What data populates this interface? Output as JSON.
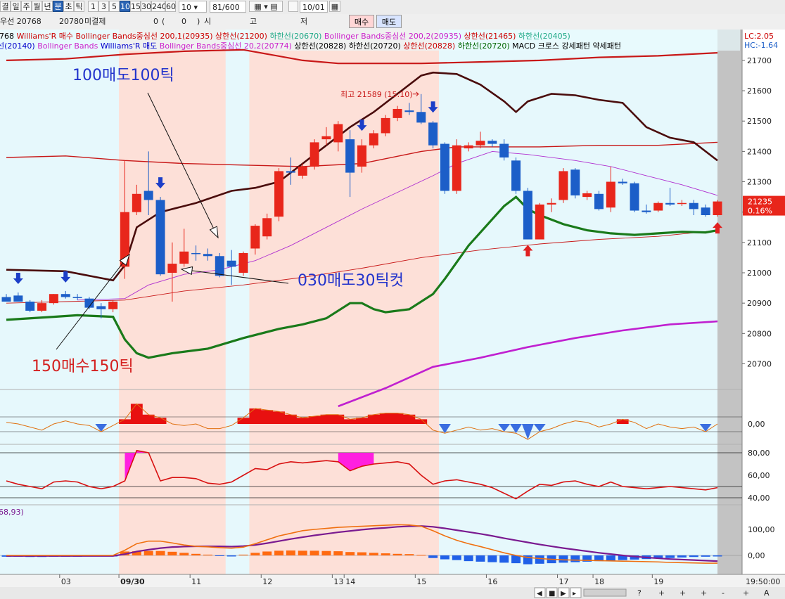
{
  "toolbar": {
    "period_tabs": [
      "결",
      "일",
      "주",
      "월",
      "년",
      "분",
      "초",
      "틱"
    ],
    "interval_buttons": [
      "1",
      "3",
      "5",
      "10",
      "15",
      "30",
      "240",
      "60"
    ],
    "selected_period": "분",
    "selected_interval": "10",
    "interval_value": "10",
    "bar_count": "81/600",
    "date_value": "10/01"
  },
  "toolbar2": {
    "item_code": "768",
    "item_label": "우선 20768",
    "price": "20780",
    "unsettled_label": "미결제",
    "unsettled_value": "0",
    "paren_value": "0",
    "open_label": "시",
    "high_label": "고",
    "low_label": "저",
    "buy_button": "매수",
    "sell_button": "매도"
  },
  "legend_line1": [
    {
      "text": "768",
      "color": "#000000"
    },
    {
      "text": "Williams'R 매수",
      "color": "#cc0000"
    },
    {
      "text": "Bollinger Bands중심선 200,1(20935)",
      "color": "#cc0000"
    },
    {
      "text": "상한선(21200)",
      "color": "#cc0000"
    },
    {
      "text": "하한선(20670)",
      "color": "#22aa88"
    },
    {
      "text": "Bollinger Bands중심선 200,2(20935)",
      "color": "#cc22cc"
    },
    {
      "text": "상한선(21465)",
      "color": "#cc0000"
    },
    {
      "text": "하한선(20405)",
      "color": "#22aa88"
    }
  ],
  "legend_line2": [
    {
      "text": "선(20140)",
      "color": "#0000cc"
    },
    {
      "text": "Bollinger Bands",
      "color": "#cc22cc"
    },
    {
      "text": "Williams'R 매도",
      "color": "#0000cc"
    },
    {
      "text": "Bollinger Bands중심선 20,2(20774)",
      "color": "#cc22cc"
    },
    {
      "text": "상한선(20828)",
      "color": "#000000"
    },
    {
      "text": "하한선(20720)",
      "color": "#000000"
    },
    {
      "text": "상한선(20828)",
      "color": "#cc0000"
    },
    {
      "text": "하한선(20720)",
      "color": "#006600"
    },
    {
      "text": "MACD 크로스 강세패턴  약세패턴",
      "color": "#000000"
    }
  ],
  "indicator_corner": {
    "lc": "LC:2.05",
    "hc": "HC:-1.64"
  },
  "annotations": {
    "sell100": "100매도100틱",
    "sell30": "030매도30틱컷",
    "buy150": "150매수150틱",
    "high_label": "최고 21589 (15:10)"
  },
  "price_tag": {
    "price": "21235",
    "pct": "0.16%"
  },
  "macd_left_label": "68,93)",
  "time_label": "19:50:00",
  "colors": {
    "up": "#e8261b",
    "down": "#1c5ec8",
    "pink_band": "#fde0d8",
    "cyan_bg": "#e6f8fc",
    "upper_band_dark": "#4a0c0c",
    "lower_band": "#1a7a1a",
    "magenta_line": "#c020d0"
  },
  "chart_data": {
    "type": "candlestick",
    "ylim": [
      20620,
      21760
    ],
    "y_ticks": [
      21700,
      21600,
      21500,
      21400,
      21300,
      21200,
      21100,
      21000,
      20900,
      20800,
      20700
    ],
    "x_ticks": [
      "03",
      "09/30",
      "11",
      "12",
      "13",
      "14",
      "15",
      "16",
      "17",
      "18",
      "19"
    ],
    "candles": [
      {
        "o": 20920,
        "h": 20930,
        "l": 20905,
        "c": 20905
      },
      {
        "o": 20925,
        "h": 20935,
        "l": 20905,
        "c": 20905
      },
      {
        "o": 20905,
        "h": 20910,
        "l": 20870,
        "c": 20875
      },
      {
        "o": 20875,
        "h": 20910,
        "l": 20870,
        "c": 20900
      },
      {
        "o": 20900,
        "h": 20930,
        "l": 20895,
        "c": 20930
      },
      {
        "o": 20930,
        "h": 20940,
        "l": 20915,
        "c": 20920
      },
      {
        "o": 20920,
        "h": 20930,
        "l": 20910,
        "c": 20918
      },
      {
        "o": 20915,
        "h": 20920,
        "l": 20880,
        "c": 20885
      },
      {
        "o": 20890,
        "h": 20900,
        "l": 20850,
        "c": 20880
      },
      {
        "o": 20880,
        "h": 20910,
        "l": 20870,
        "c": 20905
      },
      {
        "o": 21020,
        "h": 21370,
        "l": 20980,
        "c": 21200
      },
      {
        "o": 21200,
        "h": 21290,
        "l": 21190,
        "c": 21260
      },
      {
        "o": 21270,
        "h": 21400,
        "l": 21190,
        "c": 21240
      },
      {
        "o": 21240,
        "h": 21250,
        "l": 20990,
        "c": 20995
      },
      {
        "o": 21000,
        "h": 21100,
        "l": 20905,
        "c": 21030
      },
      {
        "o": 21030,
        "h": 21145,
        "l": 21020,
        "c": 21070
      },
      {
        "o": 21065,
        "h": 21090,
        "l": 21040,
        "c": 21062
      },
      {
        "o": 21062,
        "h": 21080,
        "l": 21040,
        "c": 21055
      },
      {
        "o": 21055,
        "h": 21065,
        "l": 20985,
        "c": 20990
      },
      {
        "o": 21040,
        "h": 21075,
        "l": 20960,
        "c": 21020
      },
      {
        "o": 21000,
        "h": 21070,
        "l": 20990,
        "c": 21065
      },
      {
        "o": 21080,
        "h": 21160,
        "l": 21060,
        "c": 21155
      },
      {
        "o": 21120,
        "h": 21195,
        "l": 21110,
        "c": 21180
      },
      {
        "o": 21185,
        "h": 21345,
        "l": 21170,
        "c": 21335
      },
      {
        "o": 21335,
        "h": 21380,
        "l": 21290,
        "c": 21330
      },
      {
        "o": 21320,
        "h": 21360,
        "l": 21310,
        "c": 21350
      },
      {
        "o": 21350,
        "h": 21440,
        "l": 21340,
        "c": 21430
      },
      {
        "o": 21440,
        "h": 21480,
        "l": 21420,
        "c": 21450
      },
      {
        "o": 21430,
        "h": 21500,
        "l": 21400,
        "c": 21490
      },
      {
        "o": 21440,
        "h": 21470,
        "l": 21250,
        "c": 21330
      },
      {
        "o": 21350,
        "h": 21440,
        "l": 21330,
        "c": 21420
      },
      {
        "o": 21420,
        "h": 21470,
        "l": 21410,
        "c": 21460
      },
      {
        "o": 21460,
        "h": 21520,
        "l": 21450,
        "c": 21510
      },
      {
        "o": 21510,
        "h": 21550,
        "l": 21500,
        "c": 21540
      },
      {
        "o": 21535,
        "h": 21560,
        "l": 21520,
        "c": 21530
      },
      {
        "o": 21530,
        "h": 21589,
        "l": 21490,
        "c": 21495
      },
      {
        "o": 21495,
        "h": 21500,
        "l": 21410,
        "c": 21420
      },
      {
        "o": 21425,
        "h": 21430,
        "l": 21260,
        "c": 21270
      },
      {
        "o": 21270,
        "h": 21440,
        "l": 21260,
        "c": 21420
      },
      {
        "o": 21410,
        "h": 21430,
        "l": 21400,
        "c": 21420
      },
      {
        "o": 21420,
        "h": 21465,
        "l": 21410,
        "c": 21435
      },
      {
        "o": 21435,
        "h": 21440,
        "l": 21415,
        "c": 21425
      },
      {
        "o": 21425,
        "h": 21440,
        "l": 21370,
        "c": 21380
      },
      {
        "o": 21370,
        "h": 21380,
        "l": 21260,
        "c": 21270
      },
      {
        "o": 21270,
        "h": 21280,
        "l": 21110,
        "c": 21110
      },
      {
        "o": 21110,
        "h": 21230,
        "l": 21110,
        "c": 21225
      },
      {
        "o": 21225,
        "h": 21245,
        "l": 21200,
        "c": 21230
      },
      {
        "o": 21240,
        "h": 21345,
        "l": 21230,
        "c": 21335
      },
      {
        "o": 21340,
        "h": 21345,
        "l": 21245,
        "c": 21255
      },
      {
        "o": 21250,
        "h": 21270,
        "l": 21240,
        "c": 21262
      },
      {
        "o": 21260,
        "h": 21270,
        "l": 21205,
        "c": 21210
      },
      {
        "o": 21215,
        "h": 21350,
        "l": 21200,
        "c": 21300
      },
      {
        "o": 21300,
        "h": 21310,
        "l": 21290,
        "c": 21295
      },
      {
        "o": 21295,
        "h": 21300,
        "l": 21200,
        "c": 21205
      },
      {
        "o": 21205,
        "h": 21225,
        "l": 21195,
        "c": 21200
      },
      {
        "o": 21205,
        "h": 21235,
        "l": 21200,
        "c": 21230
      },
      {
        "o": 21230,
        "h": 21280,
        "l": 21220,
        "c": 21225
      },
      {
        "o": 21230,
        "h": 21240,
        "l": 21220,
        "c": 21230
      },
      {
        "o": 21230,
        "h": 21240,
        "l": 21190,
        "c": 21210
      },
      {
        "o": 21215,
        "h": 21225,
        "l": 21185,
        "c": 21190
      },
      {
        "o": 21190,
        "h": 21240,
        "l": 21185,
        "c": 21235
      }
    ],
    "buy_signal_bars": [
      44,
      60
    ],
    "sell_signal_bars": [
      1,
      5,
      13,
      30,
      36
    ],
    "pink_shaded_bars": [
      [
        10,
        18
      ],
      [
        21,
        36
      ]
    ],
    "upper_band_dark": [
      [
        0,
        21010
      ],
      [
        5,
        21005
      ],
      [
        9,
        20975
      ],
      [
        10,
        21025
      ],
      [
        11,
        21150
      ],
      [
        13,
        21200
      ],
      [
        16,
        21230
      ],
      [
        19,
        21270
      ],
      [
        21,
        21280
      ],
      [
        23,
        21300
      ],
      [
        25,
        21360
      ],
      [
        27,
        21420
      ],
      [
        29,
        21480
      ],
      [
        31,
        21530
      ],
      [
        33,
        21590
      ],
      [
        35,
        21650
      ],
      [
        36,
        21660
      ],
      [
        38,
        21655
      ],
      [
        40,
        21620
      ],
      [
        42,
        21565
      ],
      [
        43,
        21530
      ],
      [
        44,
        21565
      ],
      [
        46,
        21590
      ],
      [
        48,
        21585
      ],
      [
        50,
        21570
      ],
      [
        52,
        21560
      ],
      [
        54,
        21480
      ],
      [
        56,
        21445
      ],
      [
        58,
        21430
      ],
      [
        60,
        21370
      ]
    ],
    "lower_band_green": [
      [
        0,
        20845
      ],
      [
        4,
        20855
      ],
      [
        6,
        20860
      ],
      [
        9,
        20855
      ],
      [
        10,
        20780
      ],
      [
        11,
        20735
      ],
      [
        12,
        20720
      ],
      [
        14,
        20735
      ],
      [
        17,
        20750
      ],
      [
        20,
        20785
      ],
      [
        23,
        20815
      ],
      [
        25,
        20830
      ],
      [
        27,
        20850
      ],
      [
        29,
        20900
      ],
      [
        30,
        20900
      ],
      [
        31,
        20880
      ],
      [
        32,
        20870
      ],
      [
        34,
        20880
      ],
      [
        36,
        20930
      ],
      [
        37,
        20980
      ],
      [
        39,
        21090
      ],
      [
        42,
        21220
      ],
      [
        43,
        21250
      ],
      [
        44,
        21210
      ],
      [
        45,
        21190
      ],
      [
        47,
        21160
      ],
      [
        49,
        21140
      ],
      [
        51,
        21130
      ],
      [
        53,
        21125
      ],
      [
        55,
        21130
      ],
      [
        57,
        21135
      ],
      [
        59,
        21133
      ],
      [
        60,
        21140
      ]
    ],
    "upper_band_red": [
      [
        0,
        21380
      ],
      [
        5,
        21385
      ],
      [
        10,
        21370
      ],
      [
        15,
        21360
      ],
      [
        20,
        21355
      ],
      [
        25,
        21350
      ],
      [
        30,
        21360
      ],
      [
        35,
        21400
      ],
      [
        38,
        21415
      ],
      [
        45,
        21415
      ],
      [
        50,
        21420
      ],
      [
        55,
        21420
      ],
      [
        60,
        21430
      ]
    ],
    "top_band_red": [
      [
        0,
        21700
      ],
      [
        5,
        21705
      ],
      [
        10,
        21720
      ],
      [
        15,
        21730
      ],
      [
        20,
        21735
      ],
      [
        25,
        21700
      ],
      [
        28,
        21690
      ],
      [
        35,
        21690
      ],
      [
        40,
        21695
      ],
      [
        45,
        21700
      ],
      [
        50,
        21710
      ],
      [
        55,
        21715
      ],
      [
        60,
        21725
      ]
    ],
    "mid_band_thin_red": [
      [
        0,
        20900
      ],
      [
        5,
        20905
      ],
      [
        10,
        20910
      ],
      [
        15,
        20940
      ],
      [
        20,
        20960
      ],
      [
        25,
        20985
      ],
      [
        30,
        21015
      ],
      [
        35,
        21050
      ],
      [
        40,
        21075
      ],
      [
        45,
        21095
      ],
      [
        50,
        21110
      ],
      [
        55,
        21120
      ],
      [
        60,
        21140
      ]
    ],
    "bb_magenta_thin": [
      [
        6,
        20910
      ],
      [
        10,
        20915
      ],
      [
        12,
        20960
      ],
      [
        15,
        20995
      ],
      [
        18,
        21010
      ],
      [
        21,
        21040
      ],
      [
        24,
        21090
      ],
      [
        27,
        21150
      ],
      [
        30,
        21210
      ],
      [
        33,
        21265
      ],
      [
        36,
        21320
      ],
      [
        38,
        21360
      ],
      [
        41,
        21400
      ],
      [
        44,
        21390
      ],
      [
        48,
        21370
      ],
      [
        51,
        21350
      ],
      [
        54,
        21320
      ],
      [
        57,
        21290
      ],
      [
        60,
        21255
      ]
    ],
    "bb_magenta_thick": [
      [
        28,
        20560
      ],
      [
        32,
        20620
      ],
      [
        36,
        20690
      ],
      [
        40,
        20720
      ],
      [
        44,
        20755
      ],
      [
        48,
        20785
      ],
      [
        52,
        20810
      ],
      [
        56,
        20830
      ],
      [
        60,
        20840
      ]
    ],
    "williams_upper_pink_segments": [
      [
        10,
        12
      ],
      [
        28,
        31
      ]
    ],
    "osc1_values": [
      0.1,
      0.0,
      -0.2,
      -0.4,
      0.0,
      0.2,
      0.0,
      -0.1,
      -0.5,
      -0.1,
      0.3,
      1.3,
      0.6,
      0.4,
      0.0,
      -0.1,
      0.0,
      -0.3,
      -0.3,
      -0.1,
      0.4,
      1.0,
      0.9,
      0.8,
      0.6,
      0.4,
      0.5,
      0.6,
      0.6,
      0.3,
      0.4,
      0.6,
      0.7,
      0.7,
      0.6,
      0.3,
      -0.4,
      -0.6,
      -0.4,
      -0.2,
      -0.4,
      -0.3,
      -0.5,
      -0.6,
      -1.0,
      -0.5,
      -0.3,
      0.0,
      0.2,
      0.1,
      -0.2,
      0.0,
      0.3,
      0.1,
      -0.3,
      0.0,
      -0.2,
      -0.3,
      -0.2,
      -0.5,
      0.0
    ],
    "osc1_ticks": [
      "0,00"
    ],
    "williams_values": [
      55,
      52,
      50,
      48,
      54,
      55,
      54,
      50,
      48,
      50,
      55,
      82,
      80,
      55,
      58,
      58,
      57,
      53,
      52,
      54,
      60,
      66,
      65,
      70,
      72,
      71,
      72,
      73,
      72,
      64,
      68,
      70,
      71,
      72,
      70,
      60,
      52,
      55,
      56,
      54,
      52,
      49,
      44,
      39,
      46,
      52,
      51,
      54,
      55,
      52,
      50,
      54,
      50,
      49,
      48,
      49,
      50,
      49,
      48,
      47,
      49
    ],
    "williams_ticks": [
      "80,00",
      "60,00",
      "40,00"
    ],
    "macd_hist": [
      -5,
      -5,
      -6,
      -6,
      -5,
      -5,
      -5,
      -4,
      -4,
      -4,
      15,
      16,
      17,
      17,
      14,
      10,
      6,
      3,
      -2,
      -4,
      3,
      10,
      15,
      18,
      19,
      18,
      18,
      17,
      16,
      13,
      12,
      10,
      8,
      6,
      5,
      2,
      -10,
      -15,
      -18,
      -22,
      -24,
      -26,
      -28,
      -30,
      -34,
      -32,
      -30,
      -28,
      -26,
      -24,
      -22,
      -20,
      -18,
      -16,
      -14,
      -12,
      -10,
      -8,
      -6,
      -5,
      -4
    ],
    "macd_line": [
      0,
      0,
      0,
      0,
      0,
      0,
      0,
      0,
      0,
      0,
      20,
      45,
      55,
      55,
      48,
      40,
      35,
      33,
      30,
      28,
      32,
      45,
      60,
      75,
      85,
      95,
      100,
      104,
      108,
      110,
      112,
      114,
      116,
      118,
      117,
      112,
      95,
      75,
      58,
      45,
      34,
      22,
      10,
      0,
      -8,
      -12,
      -15,
      -17,
      -18,
      -19,
      -20,
      -21,
      -22,
      -23,
      -24,
      -25,
      -27,
      -28,
      -29,
      -30,
      -30
    ],
    "signal_line": [
      -2,
      -2,
      -2,
      -2,
      -2,
      -2,
      -2,
      -2,
      -2,
      -2,
      5,
      15,
      22,
      28,
      32,
      34,
      35,
      35,
      35,
      34,
      36,
      40,
      47,
      55,
      63,
      70,
      77,
      83,
      89,
      94,
      99,
      103,
      106,
      110,
      112,
      113,
      110,
      104,
      97,
      90,
      83,
      75,
      66,
      58,
      50,
      42,
      35,
      28,
      22,
      16,
      10,
      5,
      0,
      -4,
      -8,
      -11,
      -14,
      -16,
      -18,
      -20,
      -22
    ],
    "macd_ticks": [
      "100,00",
      "0,00"
    ]
  }
}
